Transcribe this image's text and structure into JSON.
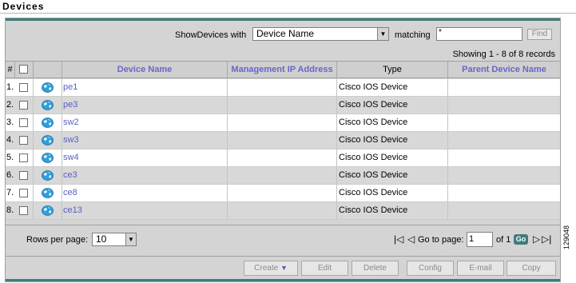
{
  "panel": {
    "title": "Devices"
  },
  "search": {
    "show_label": "ShowDevices with",
    "field_value": "Device Name",
    "matching_label": "matching",
    "match_value": "*",
    "find_label": "Find"
  },
  "summary": "Showing 1 - 8 of 8 records",
  "table": {
    "headers": {
      "num": "#",
      "device_name": "Device Name",
      "mgmt_ip": "Management IP Address",
      "type": "Type",
      "parent": "Parent Device Name"
    },
    "rows": [
      {
        "num": "1.",
        "name": "pe1",
        "ip": "",
        "type": "Cisco IOS Device",
        "parent": ""
      },
      {
        "num": "2.",
        "name": "pe3",
        "ip": "",
        "type": "Cisco IOS Device",
        "parent": ""
      },
      {
        "num": "3.",
        "name": "sw2",
        "ip": "",
        "type": "Cisco IOS Device",
        "parent": ""
      },
      {
        "num": "4.",
        "name": "sw3",
        "ip": "",
        "type": "Cisco IOS Device",
        "parent": ""
      },
      {
        "num": "5.",
        "name": "sw4",
        "ip": "",
        "type": "Cisco IOS Device",
        "parent": ""
      },
      {
        "num": "6.",
        "name": "ce3",
        "ip": "",
        "type": "Cisco IOS Device",
        "parent": ""
      },
      {
        "num": "7.",
        "name": "ce8",
        "ip": "",
        "type": "Cisco IOS Device",
        "parent": ""
      },
      {
        "num": "8.",
        "name": "ce13",
        "ip": "",
        "type": "Cisco IOS Device",
        "parent": ""
      }
    ]
  },
  "pager": {
    "rows_per_page_label": "Rows per page:",
    "rows_per_page_value": "10",
    "goto_label": "Go to page:",
    "page_value": "1",
    "of_label": "of 1",
    "go_label": "Go"
  },
  "actions": {
    "create": "Create",
    "edit": "Edit",
    "delete": "Delete",
    "config": "Config",
    "email": "E-mail",
    "copy": "Copy"
  },
  "figure_id": "129048",
  "colors": {
    "accent": "#3e7b7b",
    "link": "#5c5cc4",
    "header_link": "#6666cc"
  }
}
